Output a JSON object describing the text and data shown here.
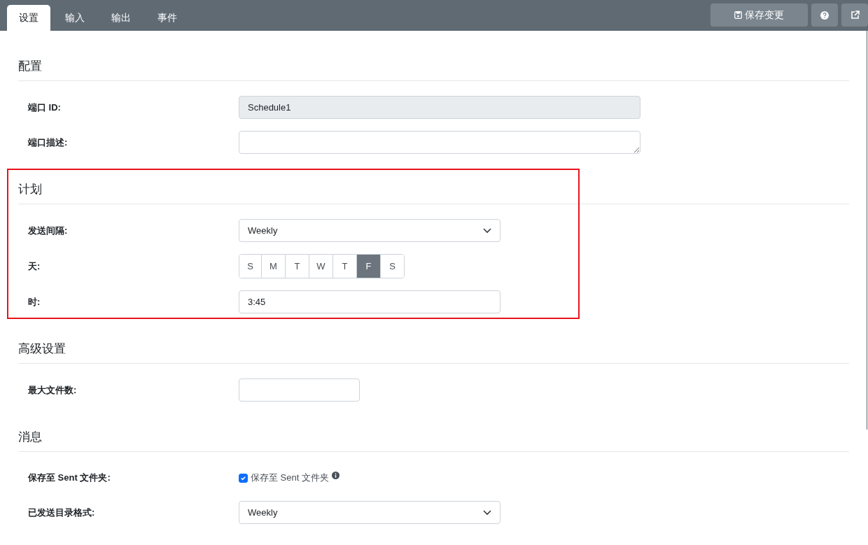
{
  "tabs": [
    {
      "label": "设置",
      "selected": true
    },
    {
      "label": "输入",
      "selected": false
    },
    {
      "label": "输出",
      "selected": false
    },
    {
      "label": "事件",
      "selected": false
    }
  ],
  "toolbar": {
    "save_button": "保存变更"
  },
  "sections": [
    {
      "title": "配置",
      "highlighted": false,
      "rows": [
        {
          "kind": "readonly",
          "label": "端口 ID:",
          "value": "Schedule1"
        },
        {
          "kind": "textarea",
          "label": "端口描述:"
        }
      ]
    },
    {
      "title": "计划",
      "highlighted": true,
      "rows": [
        {
          "kind": "select",
          "label": "发送间隔:",
          "value": "Weekly"
        },
        {
          "kind": "days",
          "label": "天:",
          "days": [
            {
              "label": "S",
              "selected": false
            },
            {
              "label": "M",
              "selected": false
            },
            {
              "label": "T",
              "selected": false
            },
            {
              "label": "W",
              "selected": false
            },
            {
              "label": "T",
              "selected": false
            },
            {
              "label": "F",
              "selected": true
            },
            {
              "label": "S",
              "selected": false
            }
          ]
        },
        {
          "kind": "text",
          "label": "时:",
          "value": "3:45"
        }
      ]
    },
    {
      "title": "高级设置",
      "highlighted": false,
      "rows": [
        {
          "kind": "short",
          "label": "最大文件数:"
        }
      ]
    },
    {
      "title": "消息",
      "highlighted": false,
      "rows": [
        {
          "kind": "checkbox",
          "label": "保存至 Sent 文件夹:",
          "text": "保存至 Sent 文件夹",
          "checked": true
        },
        {
          "kind": "select",
          "label": "已发送目录格式:",
          "value": "Weekly"
        }
      ]
    }
  ]
}
